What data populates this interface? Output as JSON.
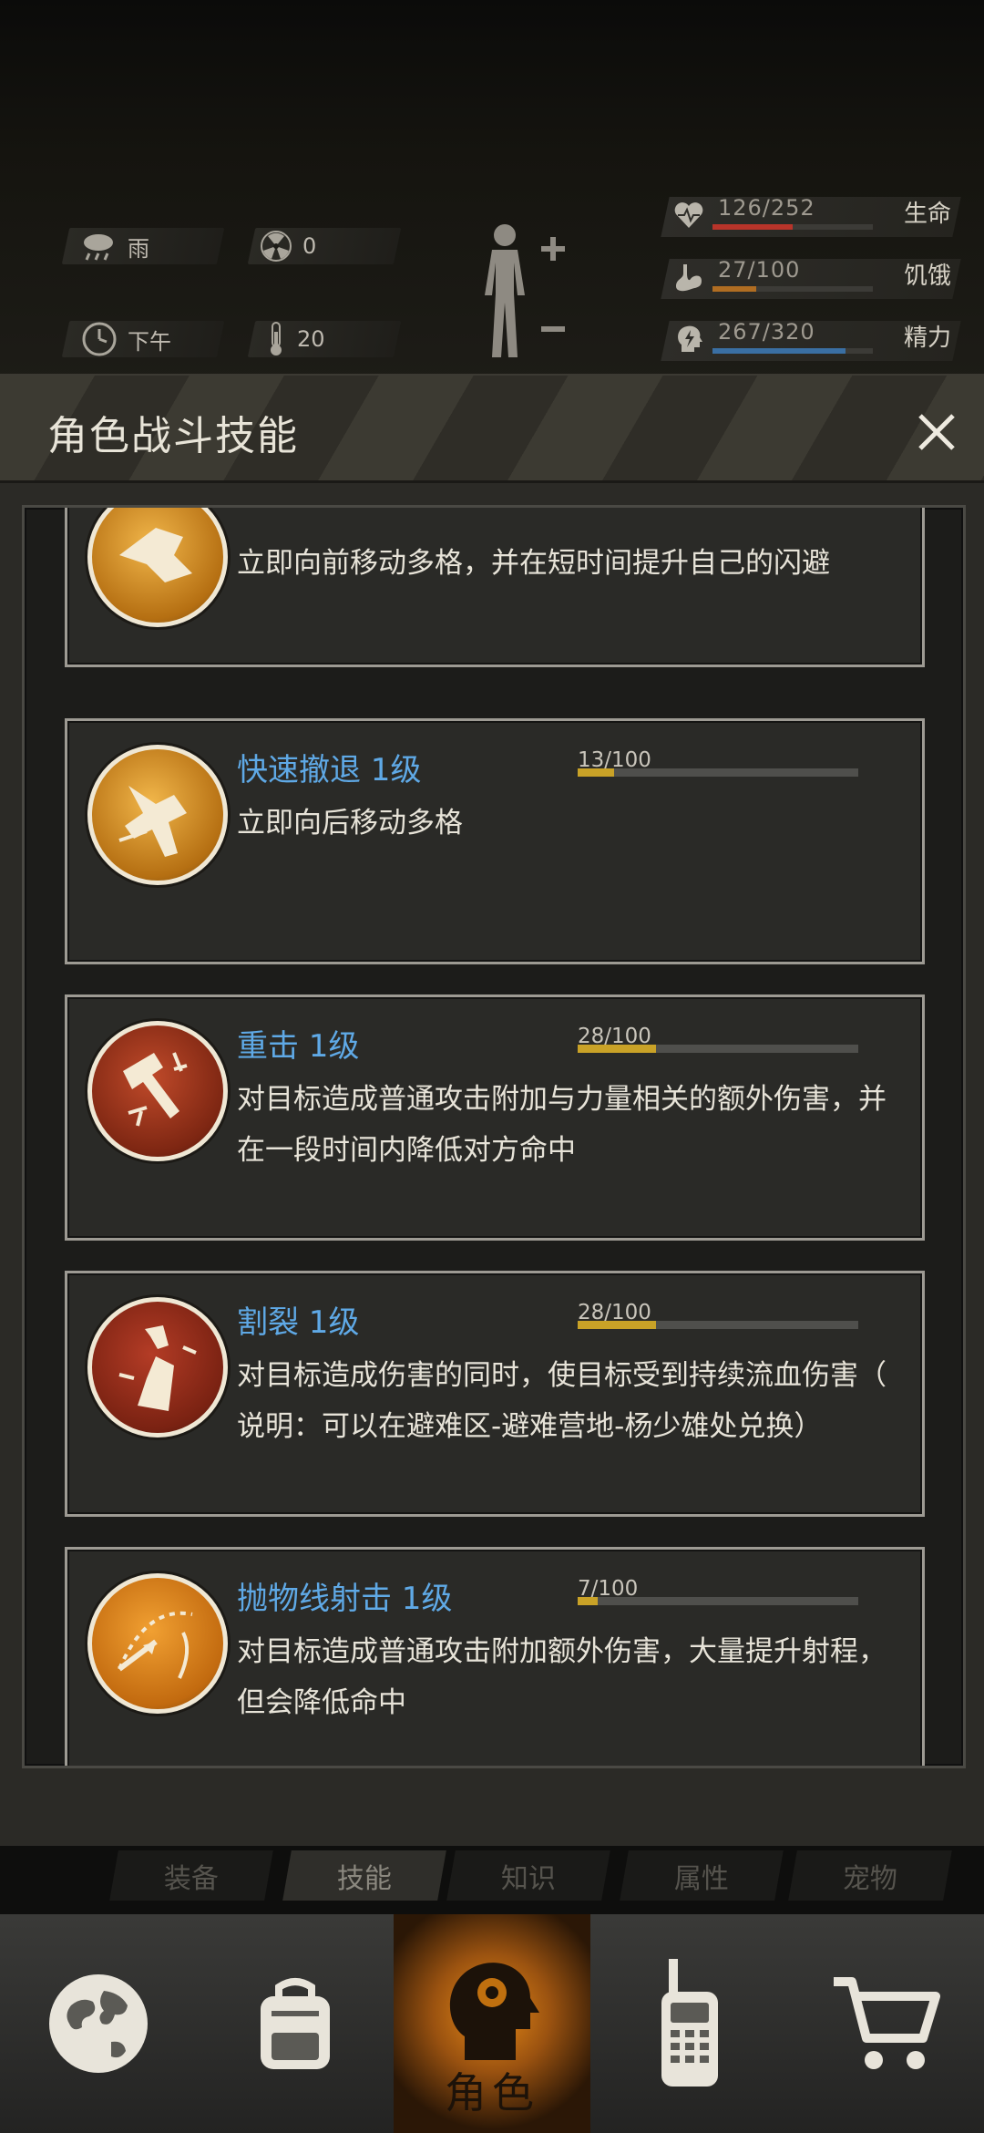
{
  "status": {
    "weather": "雨",
    "radiation": "0",
    "time_of_day": "下午",
    "temperature": "20",
    "health": {
      "text": "126/252",
      "label": "生命",
      "fraction": 0.5,
      "color": "#b8342a"
    },
    "hunger": {
      "text": "27/100",
      "label": "饥饿",
      "fraction": 0.27,
      "color": "#b06d22"
    },
    "energy": {
      "text": "267/320",
      "label": "精力",
      "fraction": 0.83,
      "color": "#3a6fa3"
    }
  },
  "dialog": {
    "title": "角色战斗技能",
    "close_icon": "close-icon"
  },
  "skills": [
    {
      "name": "",
      "desc": "立即向前移动多格，并在短时间提升自己的闪避",
      "icon": "dash-forward-icon",
      "accent": "#c98a1e"
    },
    {
      "name": "快速撤退 1级",
      "progress_text": "13/100",
      "progress": 0.13,
      "desc": "立即向后移动多格",
      "icon": "retreat-icon",
      "accent": "#c98a1e"
    },
    {
      "name": "重击 1级",
      "progress_text": "28/100",
      "progress": 0.28,
      "desc_line1": "对目标造成普通攻击附加与力量相关的额外伤害，并",
      "desc_line2": "在一段时间内降低对方命中",
      "icon": "heavy-strike-icon",
      "accent": "#8c2a17"
    },
    {
      "name": "割裂 1级",
      "progress_text": "28/100",
      "progress": 0.28,
      "desc_line1": "对目标造成伤害的同时，使目标受到持续流血伤害（",
      "desc_line2": "说明：可以在避难区-避难营地-杨少雄处兑换）",
      "icon": "laceration-icon",
      "accent": "#8c2a17"
    },
    {
      "name": "抛物线射击 1级",
      "progress_text": "7/100",
      "progress": 0.07,
      "desc_line1": "对目标造成普通攻击附加额外伤害，大量提升射程，",
      "desc_line2": "但会降低命中",
      "icon": "parabolic-shot-icon",
      "accent": "#d18a17"
    }
  ],
  "sub_tabs": [
    "装备",
    "技能",
    "知识",
    "属性",
    "宠物"
  ],
  "active_sub_tab": "技能",
  "nav": {
    "items": [
      "globe-icon",
      "backpack-icon",
      "character-icon",
      "walkie-talkie-icon",
      "shopping-cart-icon"
    ],
    "active_label": "角色"
  }
}
